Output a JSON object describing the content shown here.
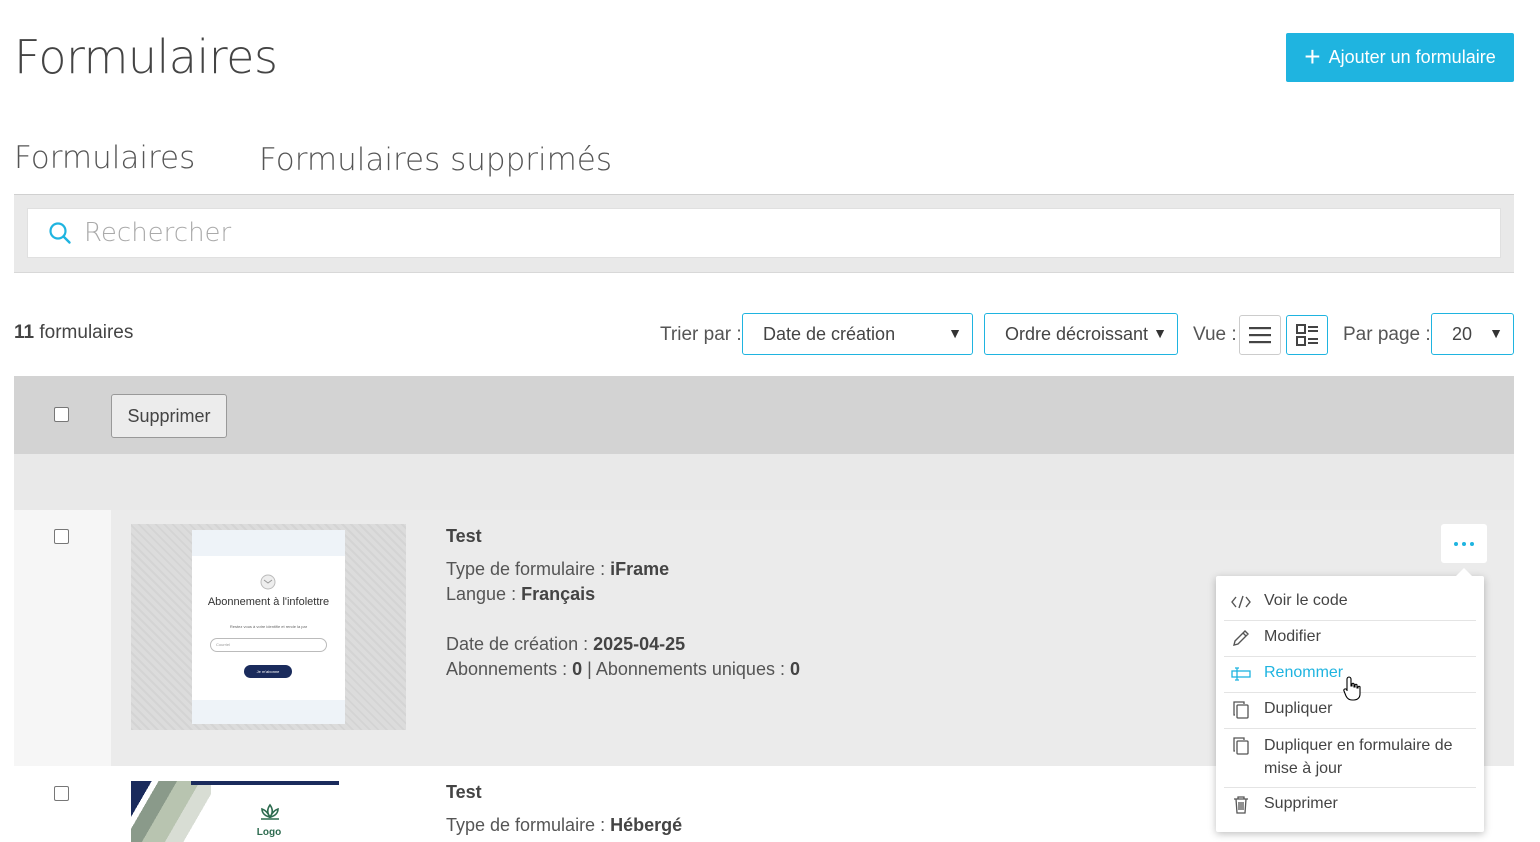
{
  "page": {
    "title": "Formulaires",
    "add_button_label": "Ajouter un formulaire"
  },
  "tabs": [
    {
      "label": "Formulaires",
      "active": true
    },
    {
      "label": "Formulaires supprimés",
      "active": false
    }
  ],
  "search": {
    "placeholder": "Rechercher"
  },
  "toolbar": {
    "count_number": "11",
    "count_label": "formulaires",
    "sort_label": "Trier par :",
    "sort_field": "Date de création",
    "sort_order": "Ordre décroissant",
    "view_label": "Vue :",
    "per_page_label": "Par page :",
    "per_page_value": "20"
  },
  "bulk": {
    "delete_label": "Supprimer"
  },
  "forms": [
    {
      "title": "Test",
      "type_label": "Type de formulaire :",
      "type_value": "iFrame",
      "lang_label": "Langue :",
      "lang_value": "Français",
      "date_label": "Date de création :",
      "date_value": "2025-04-25",
      "subs_label": "Abonnements :",
      "subs_value": "0",
      "sep": "|",
      "unique_label": "Abonnements uniques :",
      "unique_value": "0",
      "thumb": {
        "title": "Abonnement à l'infolettre",
        "subtitle": "Restez vous à votre identifie et rende la par",
        "field": "Courriel",
        "button": "Je m'abonne"
      }
    },
    {
      "title": "Test",
      "type_label": "Type de formulaire :",
      "type_value": "Hébergé",
      "thumb": {
        "logo": "Logo"
      }
    }
  ],
  "menu": {
    "items": [
      {
        "label": "Voir le code",
        "icon": "code-icon"
      },
      {
        "label": "Modifier",
        "icon": "pencil-icon"
      },
      {
        "label": "Renommer",
        "icon": "rename-icon",
        "highlighted": true
      },
      {
        "label": "Dupliquer",
        "icon": "duplicate-icon"
      },
      {
        "label": "Dupliquer en formulaire de mise à jour",
        "icon": "duplicate-icon"
      },
      {
        "label": "Supprimer",
        "icon": "trash-icon"
      }
    ]
  },
  "colors": {
    "accent": "#1fb4e0",
    "navy": "#1a2b5c"
  }
}
